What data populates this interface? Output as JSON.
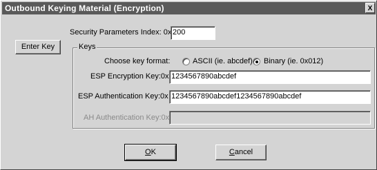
{
  "window": {
    "title": "Outbound Keying Material (Encryption)",
    "close_glyph": "X"
  },
  "spi": {
    "label": "Security Parameters Index: 0x",
    "value": "200"
  },
  "enter_key_button": "Enter Key",
  "keys_group": {
    "legend": "Keys",
    "format_label": "Choose key format:",
    "options": [
      {
        "label": "ASCII (ie. abcdef)",
        "selected": false
      },
      {
        "label": "Binary (ie. 0x012)",
        "selected": true
      }
    ],
    "esp_encryption": {
      "label": "ESP Encryption Key:0x",
      "value": "1234567890abcdef"
    },
    "esp_authentication": {
      "label": "ESP Authentication Key:0x",
      "value": "1234567890abcdef1234567890abcdef"
    },
    "ah_authentication": {
      "label": "AH Authentication Key:0x",
      "value": "",
      "disabled": true
    }
  },
  "ok_button": {
    "underline": "O",
    "rest": "K"
  },
  "cancel_button": {
    "underline": "C",
    "rest": "ancel"
  }
}
